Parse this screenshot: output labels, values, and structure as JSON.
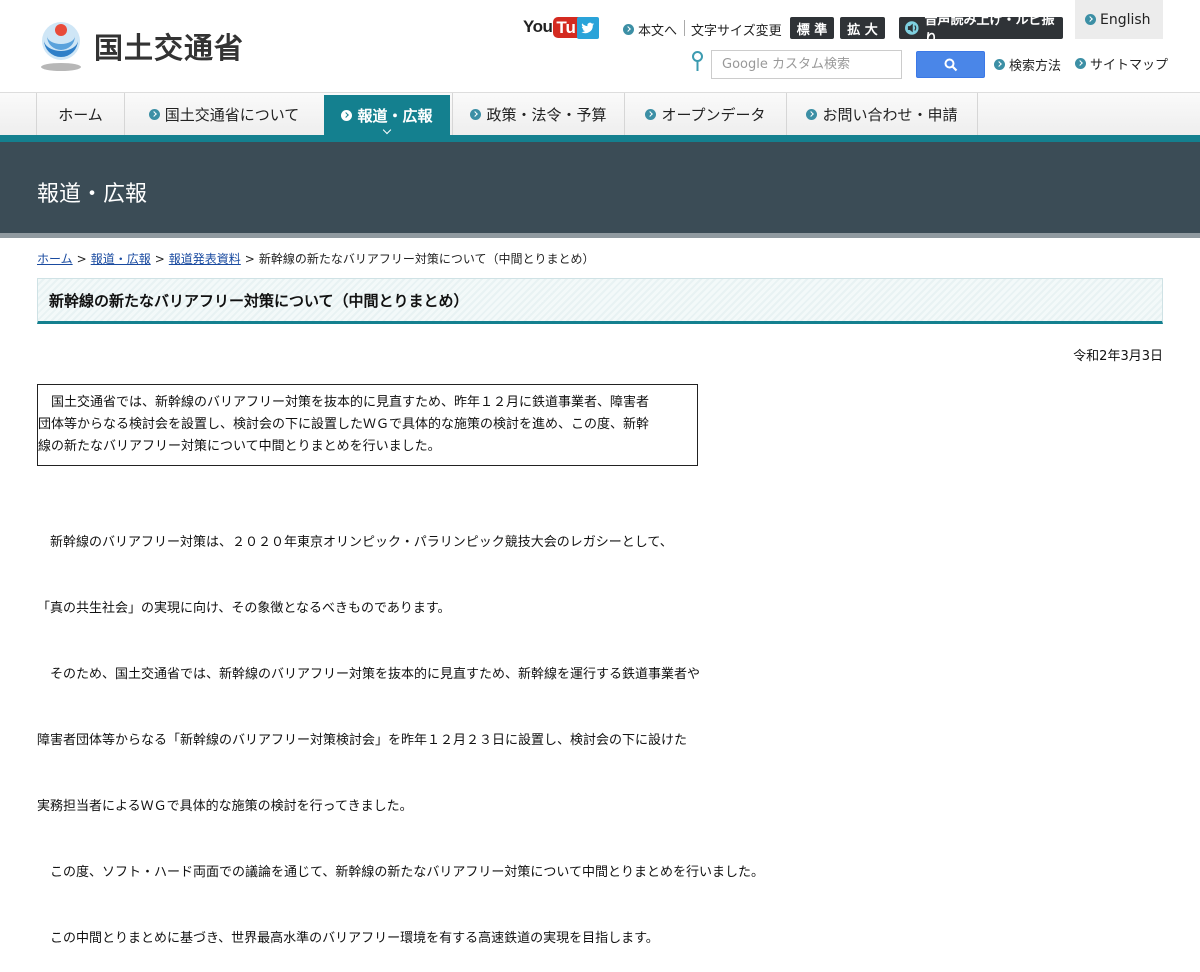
{
  "site": {
    "logo_text": "国土交通省"
  },
  "header": {
    "youtube": {
      "you": "You",
      "tube": "Tube"
    },
    "links": {
      "main_text": "本文へ",
      "font_size_label": "文字サイズ変更",
      "font_standard": "標 準",
      "font_large": "拡 大",
      "read_aloud": "音声読み上げ・ルビ振り",
      "english": "English",
      "search_method": "検索方法",
      "sitemap": "サイトマップ"
    },
    "search": {
      "placeholder": "Google カスタム検索"
    }
  },
  "nav": {
    "items": [
      {
        "label": "ホーム"
      },
      {
        "label": "国土交通省について"
      },
      {
        "label": "報道・広報",
        "active": true
      },
      {
        "label": "政策・法令・予算"
      },
      {
        "label": "オープンデータ"
      },
      {
        "label": "お問い合わせ・申請"
      }
    ]
  },
  "section": {
    "title": "報道・広報"
  },
  "breadcrumb": {
    "home": "ホーム",
    "press": "報道・広報",
    "releases": "報道発表資料",
    "current": "新幹線の新たなバリアフリー対策について（中間とりまとめ）",
    "separator": ">"
  },
  "article": {
    "title": "新幹線の新たなバリアフリー対策について（中間とりまとめ）",
    "date": "令和2年3月3日",
    "summary": [
      "　国土交通省では、新幹線のバリアフリー対策を抜本的に見直すため、昨年１２月に鉄道事業者、障害者",
      "団体等からなる検討会を設置し、検討会の下に設置したＷＧで具体的な施策の検討を進め、この度、新幹",
      "線の新たなバリアフリー対策について中間とりまとめを行いました。"
    ],
    "body": [
      "　新幹線のバリアフリー対策は、２０２０年東京オリンピック・パラリンピック競技大会のレガシーとして、",
      "「真の共生社会」の実現に向け、その象徴となるべきものであります。",
      "　そのため、国土交通省では、新幹線のバリアフリー対策を抜本的に見直すため、新幹線を運行する鉄道事業者や",
      "障害者団体等からなる「新幹線のバリアフリー対策検討会」を昨年１２月２３日に設置し、検討会の下に設けた",
      "実務担当者によるＷＧで具体的な施策の検討を行ってきました。",
      "　この度、ソフト・ハード両面での議論を通じて、新幹線の新たなバリアフリー対策について中間とりまとめを行いました。",
      "　この中間とりまとめに基づき、世界最高水準のバリアフリー環境を有する高速鉄道の実現を目指します。"
    ]
  },
  "colors": {
    "accent": "#14808f",
    "band": "#3b4c56",
    "link": "#1a4ba0"
  }
}
